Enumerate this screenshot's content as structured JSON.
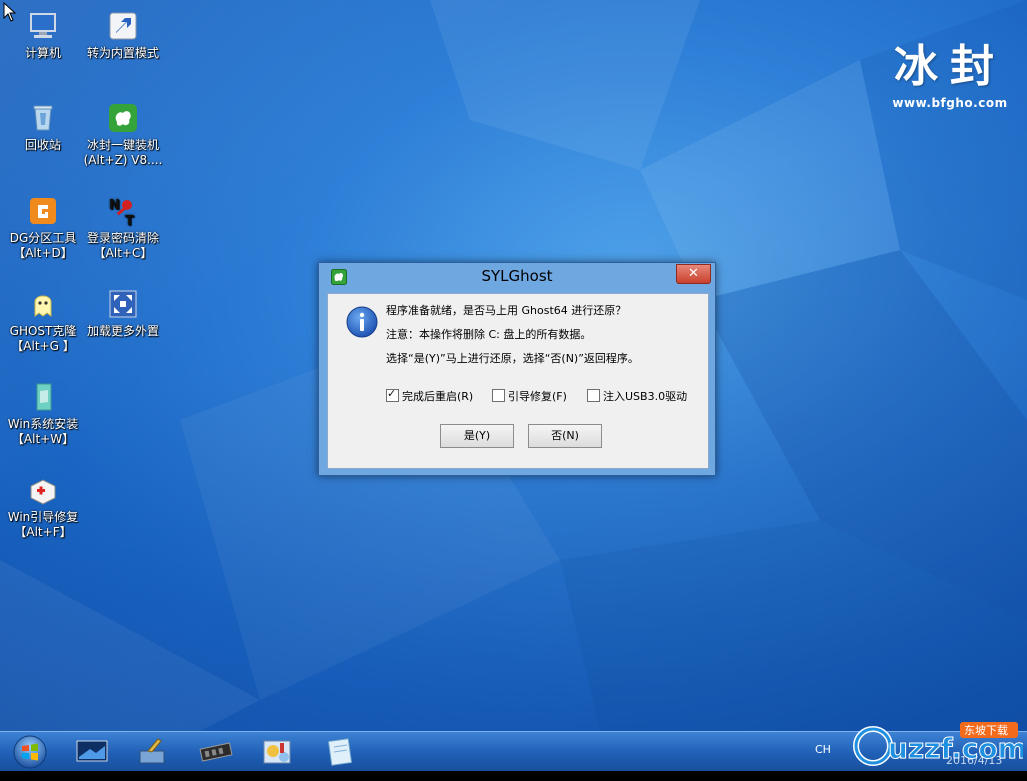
{
  "desktop": {
    "icons": [
      {
        "label1": "计算机",
        "label2": ""
      },
      {
        "label1": "转为内置模式",
        "label2": ""
      },
      {
        "label1": "回收站",
        "label2": ""
      },
      {
        "label1": "冰封一键装机",
        "label2": "(Alt+Z) V8...."
      },
      {
        "label1": "DG分区工具",
        "label2": "【Alt+D】"
      },
      {
        "label1": "登录密码清除",
        "label2": "【Alt+C】"
      },
      {
        "label1": "GHOST克隆",
        "label2": "【Alt+G 】"
      },
      {
        "label1": "加载更多外置",
        "label2": ""
      },
      {
        "label1": "Win系统安装",
        "label2": "【Alt+W】"
      },
      {
        "label1": "Win引导修复",
        "label2": "【Alt+F】"
      }
    ]
  },
  "brand": {
    "title": "冰封",
    "url": "www.bfgho.com"
  },
  "dialog": {
    "title": "SYLGhost",
    "close_label": "✕",
    "message1": "程序准备就绪，是否马上用 Ghost64 进行还原？",
    "message2": "注意：本操作将删除 C: 盘上的所有数据。",
    "message3": "选择“是(Y)”马上进行还原，选择“否(N)”返回程序。",
    "options": [
      {
        "label": "完成后重启(R)",
        "checked": true
      },
      {
        "label": "引导修复(F)",
        "checked": false
      },
      {
        "label": "注入USB3.0驱动",
        "checked": false
      }
    ],
    "yes_label": "是(Y)",
    "no_label": "否(N)"
  },
  "taskbar": {
    "lang": "CH",
    "clock": "2016/4/13"
  },
  "watermark": {
    "text": "uzzf.com",
    "tag": "东坡下载"
  }
}
